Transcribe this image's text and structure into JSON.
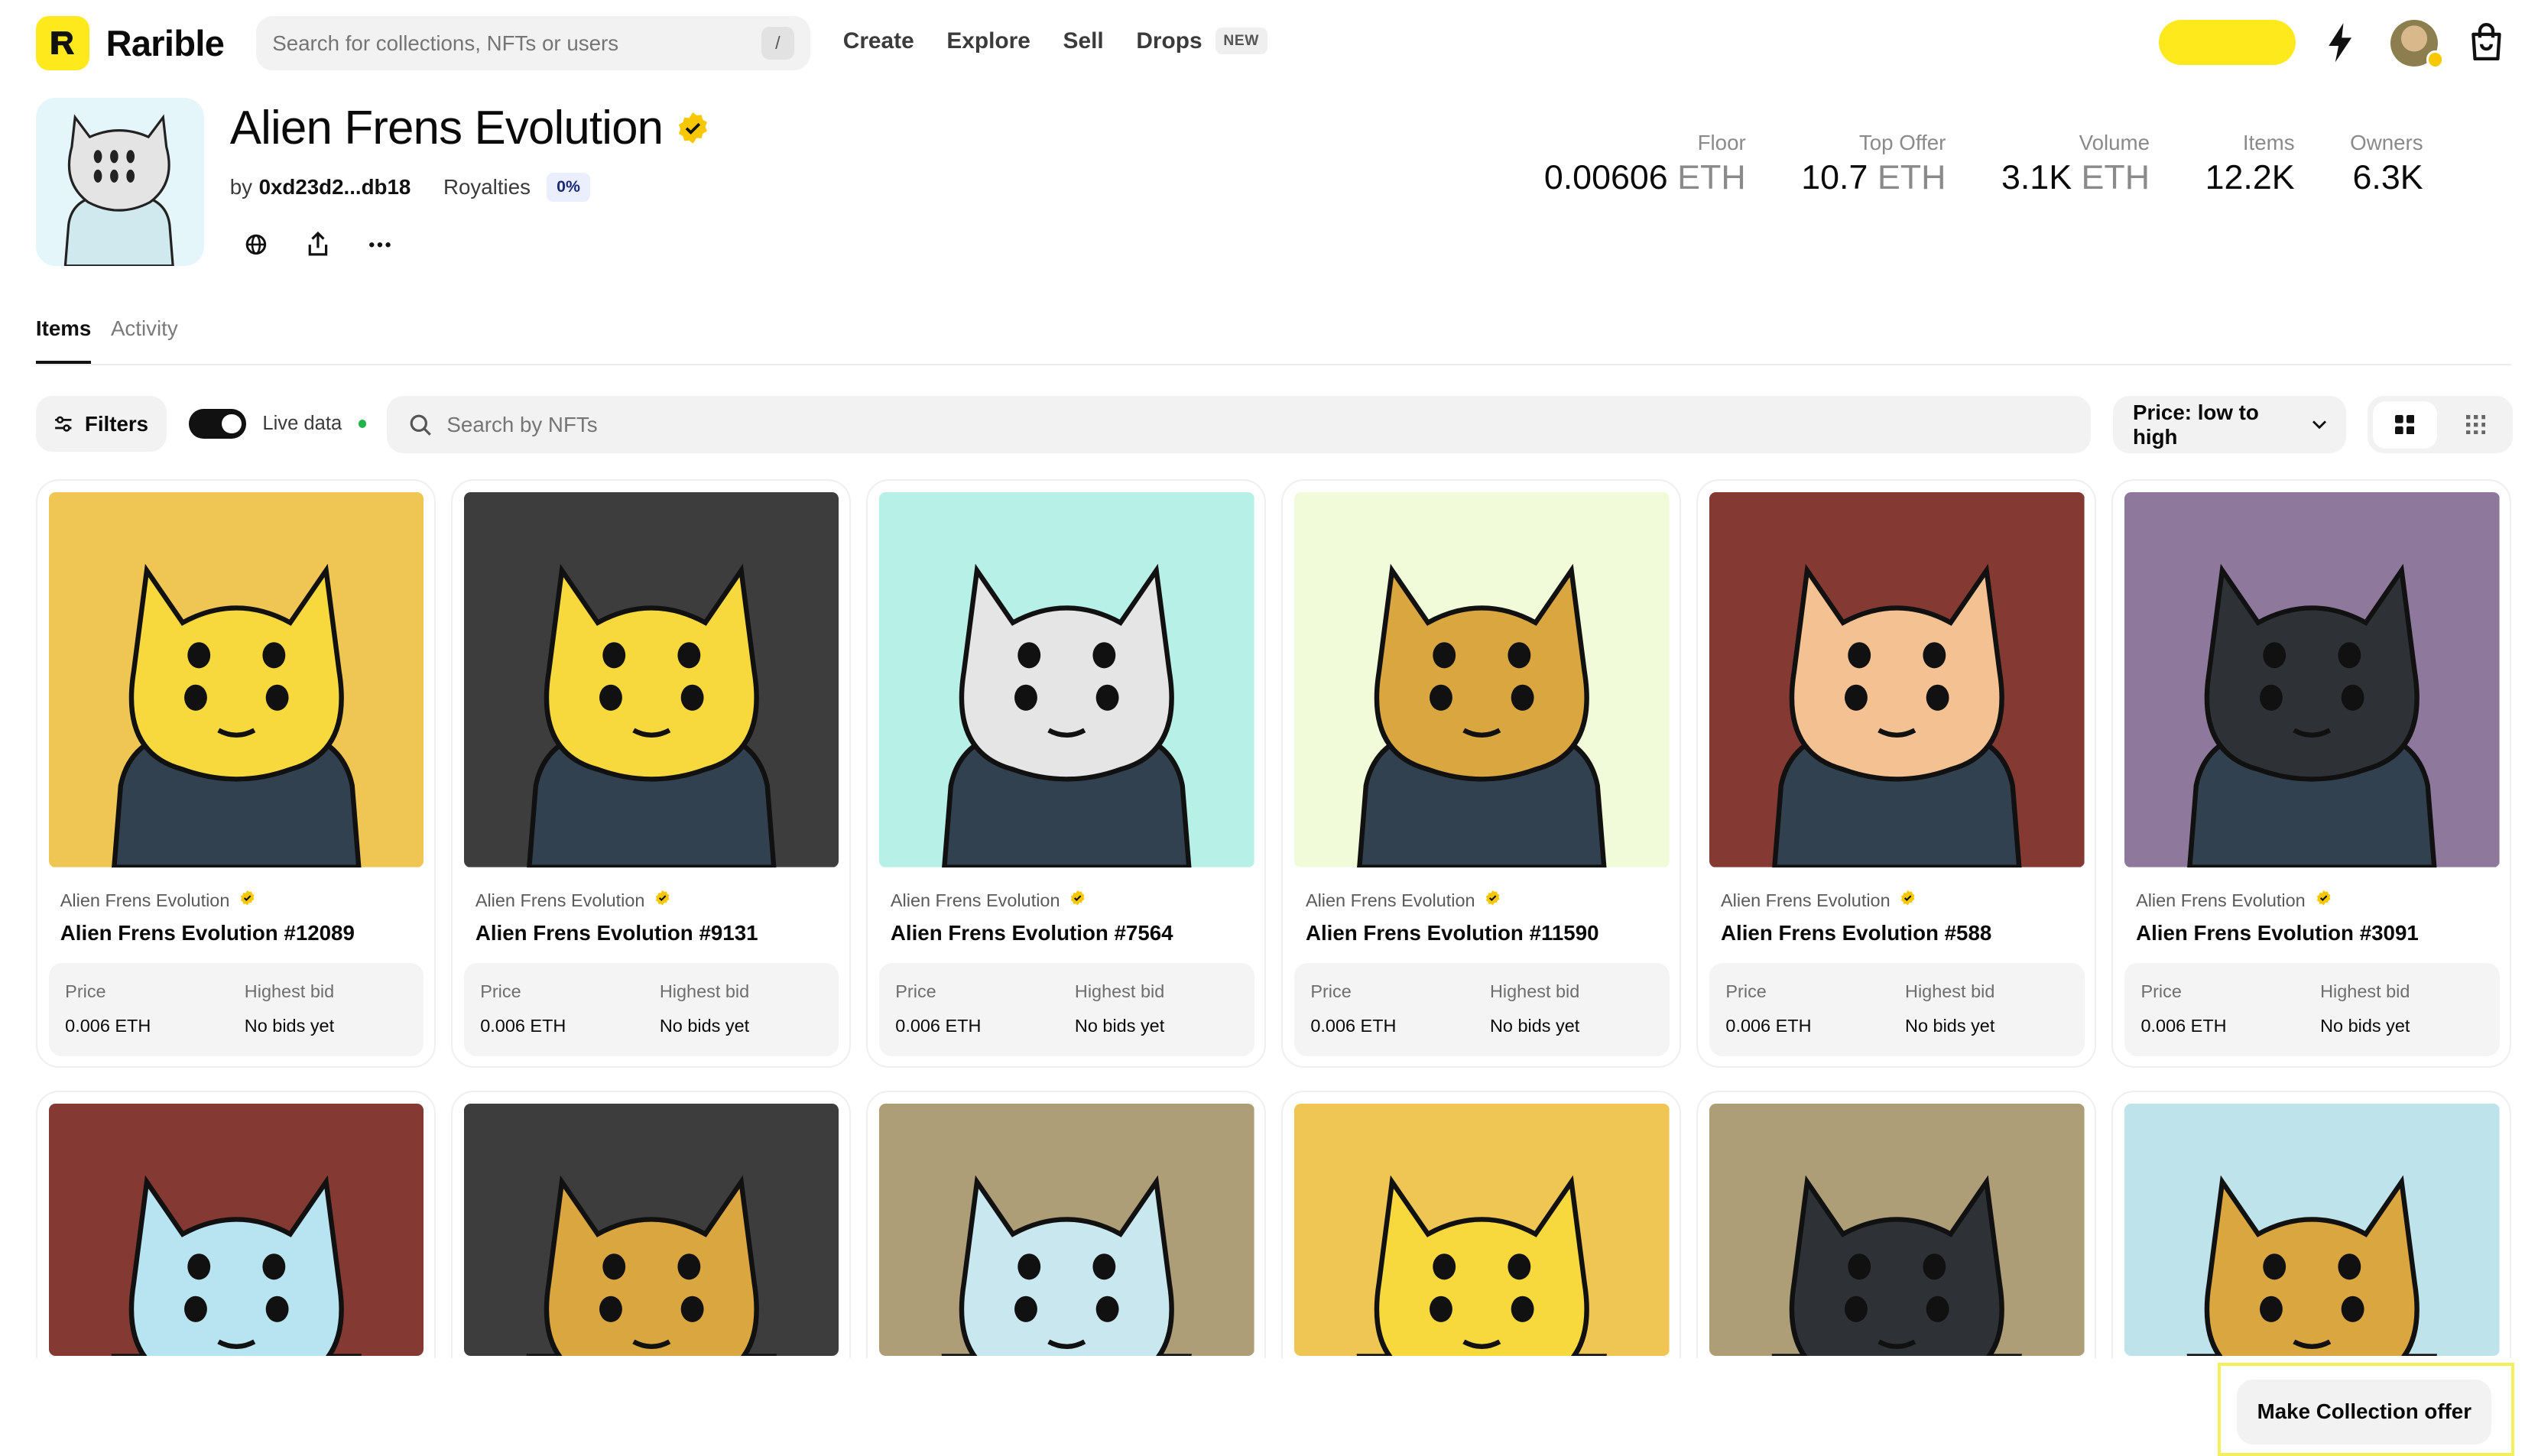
{
  "app": {
    "name": "Rarible"
  },
  "search": {
    "placeholder": "Search for collections, NFTs or users",
    "shortcut": "/"
  },
  "nav": {
    "create": "Create",
    "explore": "Explore",
    "sell": "Sell",
    "drops": "Drops",
    "drops_badge": "NEW"
  },
  "colors": {
    "brand": "#fee91c",
    "verified": "#f7c700",
    "live": "#22b34b"
  },
  "collection": {
    "title": "Alien Frens Evolution",
    "by_prefix": "by",
    "creator": "0xd23d2...db18",
    "royalties_label": "Royalties",
    "royalties_value": "0%"
  },
  "stats": [
    {
      "label": "Floor",
      "value": "0.00606",
      "unit": "ETH"
    },
    {
      "label": "Top Offer",
      "value": "10.7",
      "unit": "ETH"
    },
    {
      "label": "Volume",
      "value": "3.1K",
      "unit": "ETH"
    },
    {
      "label": "Items",
      "value": "12.2K",
      "unit": ""
    },
    {
      "label": "Owners",
      "value": "6.3K",
      "unit": ""
    }
  ],
  "tabs": {
    "items": "Items",
    "activity": "Activity"
  },
  "toolbar": {
    "filters": "Filters",
    "live_data": "Live data",
    "nft_search_placeholder": "Search by NFTs",
    "sort": "Price: low to high"
  },
  "labels": {
    "price": "Price",
    "highest_bid": "Highest bid"
  },
  "items": [
    {
      "collection": "Alien Frens Evolution",
      "name": "Alien Frens Evolution #12089",
      "price": "0.006 ETH",
      "bid": "No bids yet",
      "bg": "#efc654",
      "face": "#f7d93d",
      "horn": "#f7d93d"
    },
    {
      "collection": "Alien Frens Evolution",
      "name": "Alien Frens Evolution #9131",
      "price": "0.006 ETH",
      "bid": "No bids yet",
      "bg": "#3d3d3d",
      "face": "#f7d93d",
      "horn": "#f7d93d"
    },
    {
      "collection": "Alien Frens Evolution",
      "name": "Alien Frens Evolution #7564",
      "price": "0.006 ETH",
      "bid": "No bids yet",
      "bg": "#b7f0e6",
      "face": "#e5e5e5",
      "horn": "#e5e5e5"
    },
    {
      "collection": "Alien Frens Evolution",
      "name": "Alien Frens Evolution #11590",
      "price": "0.006 ETH",
      "bid": "No bids yet",
      "bg": "#f1fbd9",
      "face": "#d9a640",
      "horn": "#d9a640"
    },
    {
      "collection": "Alien Frens Evolution",
      "name": "Alien Frens Evolution #588",
      "price": "0.006 ETH",
      "bid": "No bids yet",
      "bg": "#843932",
      "face": "#f4c192",
      "horn": "#f4c192"
    },
    {
      "collection": "Alien Frens Evolution",
      "name": "Alien Frens Evolution #3091",
      "price": "0.006 ETH",
      "bid": "No bids yet",
      "bg": "#8e799d",
      "face": "#2e3236",
      "horn": "#2e3236"
    }
  ],
  "items_row2": [
    {
      "bg": "#843932",
      "face": "#b8e3f0"
    },
    {
      "bg": "#3d3d3d",
      "face": "#d9a640"
    },
    {
      "bg": "#ae9e78",
      "face": "#c9e7ee"
    },
    {
      "bg": "#efc654",
      "face": "#f7d93d"
    },
    {
      "bg": "#ae9e78",
      "face": "#2e3236"
    },
    {
      "bg": "#bfe3ea",
      "face": "#d9a640"
    }
  ],
  "offer_button": "Make Collection offer"
}
